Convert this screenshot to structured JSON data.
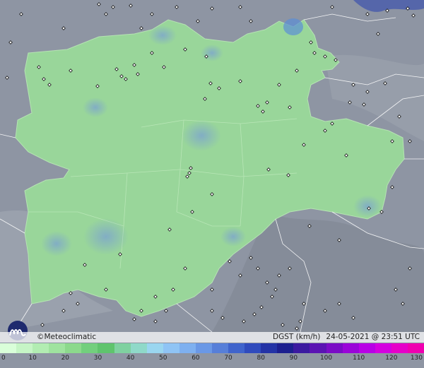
{
  "branding": {
    "name": "Meteoclimatic",
    "copyright": "©"
  },
  "variable": "DGST (km/h)",
  "timestamp": "24-05-2021 @ 23:51 UTC",
  "scale": {
    "ticks": [
      0,
      10,
      20,
      30,
      40,
      50,
      60,
      70,
      80,
      90,
      100,
      110,
      120,
      130
    ],
    "colors": [
      "#d9ffd9",
      "#c6f5c6",
      "#b2edb2",
      "#9fe39f",
      "#8cd98c",
      "#72cf7d",
      "#5fc46d",
      "#7fd1a0",
      "#8fd9c9",
      "#9ad6f0",
      "#8fc4f5",
      "#7eb0f0",
      "#6a98e6",
      "#567fd9",
      "#3f64cc",
      "#2f4bbd",
      "#2333a6",
      "#1c1f8f",
      "#3b1aa0",
      "#5a13b3",
      "#7a0cc6",
      "#9a05d9",
      "#b800e6",
      "#d400e0",
      "#e600c9",
      "#ef00b0"
    ]
  },
  "colors": {
    "region_fill": "#99d69a",
    "background_terrain": "#8e95a3",
    "station_marker": "#111111"
  }
}
